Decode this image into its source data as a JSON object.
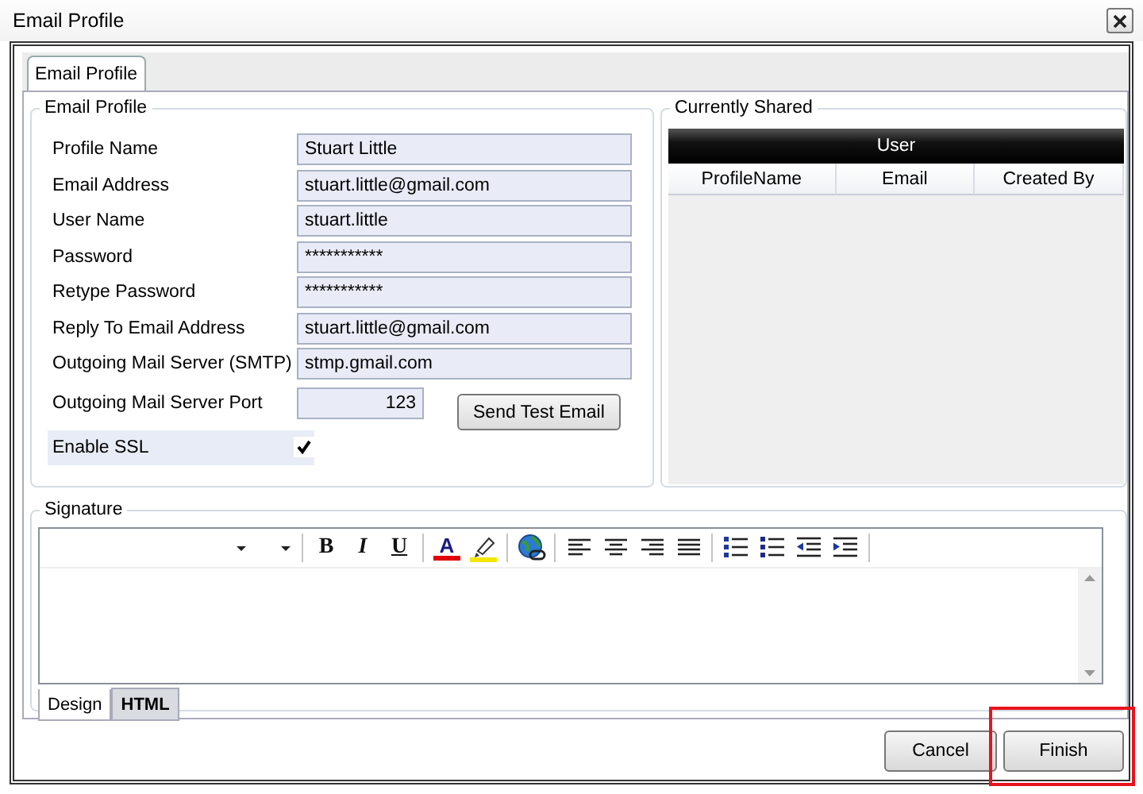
{
  "window": {
    "title": "Email Profile"
  },
  "tabs": [
    {
      "label": "Email Profile",
      "selected": true
    }
  ],
  "profile_group": {
    "title": "Email Profile",
    "fields": [
      {
        "label": "Profile Name",
        "value": "Stuart Little"
      },
      {
        "label": "Email Address",
        "value": "stuart.little@gmail.com"
      },
      {
        "label": "User Name",
        "value": "stuart.little"
      },
      {
        "label": "Password",
        "value": "***********"
      },
      {
        "label": "Retype Password",
        "value": "***********"
      },
      {
        "label": "Reply To Email Address",
        "value": "stuart.little@gmail.com"
      },
      {
        "label": "Outgoing Mail Server (SMTP)",
        "value": "stmp.gmail.com"
      },
      {
        "label": "Outgoing Mail Server Port",
        "value": "123",
        "kind": "number"
      }
    ],
    "send_test_button": "Send Test Email",
    "enable_ssl": {
      "label": "Enable SSL",
      "checked": true
    }
  },
  "shared_group": {
    "title": "Currently Shared",
    "table": {
      "group_header": "User",
      "columns": [
        "ProfileName",
        "Email",
        "Created By"
      ]
    }
  },
  "signature": {
    "title": "Signature",
    "toolbar": [
      [
        {
          "kind": "font-dropdown"
        },
        {
          "kind": "size-dropdown"
        }
      ],
      [
        {
          "kind": "bold",
          "label": "B"
        },
        {
          "kind": "italic",
          "label": "I"
        },
        {
          "kind": "underline",
          "label": "U"
        }
      ],
      [
        {
          "kind": "font-color",
          "label": "A"
        },
        {
          "kind": "highlight"
        }
      ],
      [
        {
          "kind": "link"
        }
      ],
      [
        {
          "kind": "align-left"
        },
        {
          "kind": "align-center"
        },
        {
          "kind": "align-right"
        },
        {
          "kind": "justify"
        }
      ],
      [
        {
          "kind": "numbered-list"
        },
        {
          "kind": "bullet-list"
        },
        {
          "kind": "outdent"
        },
        {
          "kind": "indent"
        }
      ]
    ],
    "tabs": [
      {
        "label": "Design",
        "selected": true
      },
      {
        "label": "HTML",
        "selected": false
      }
    ]
  },
  "buttons": [
    {
      "label": "Cancel",
      "highlighted": false
    },
    {
      "label": "Finish",
      "highlighted": true
    }
  ]
}
